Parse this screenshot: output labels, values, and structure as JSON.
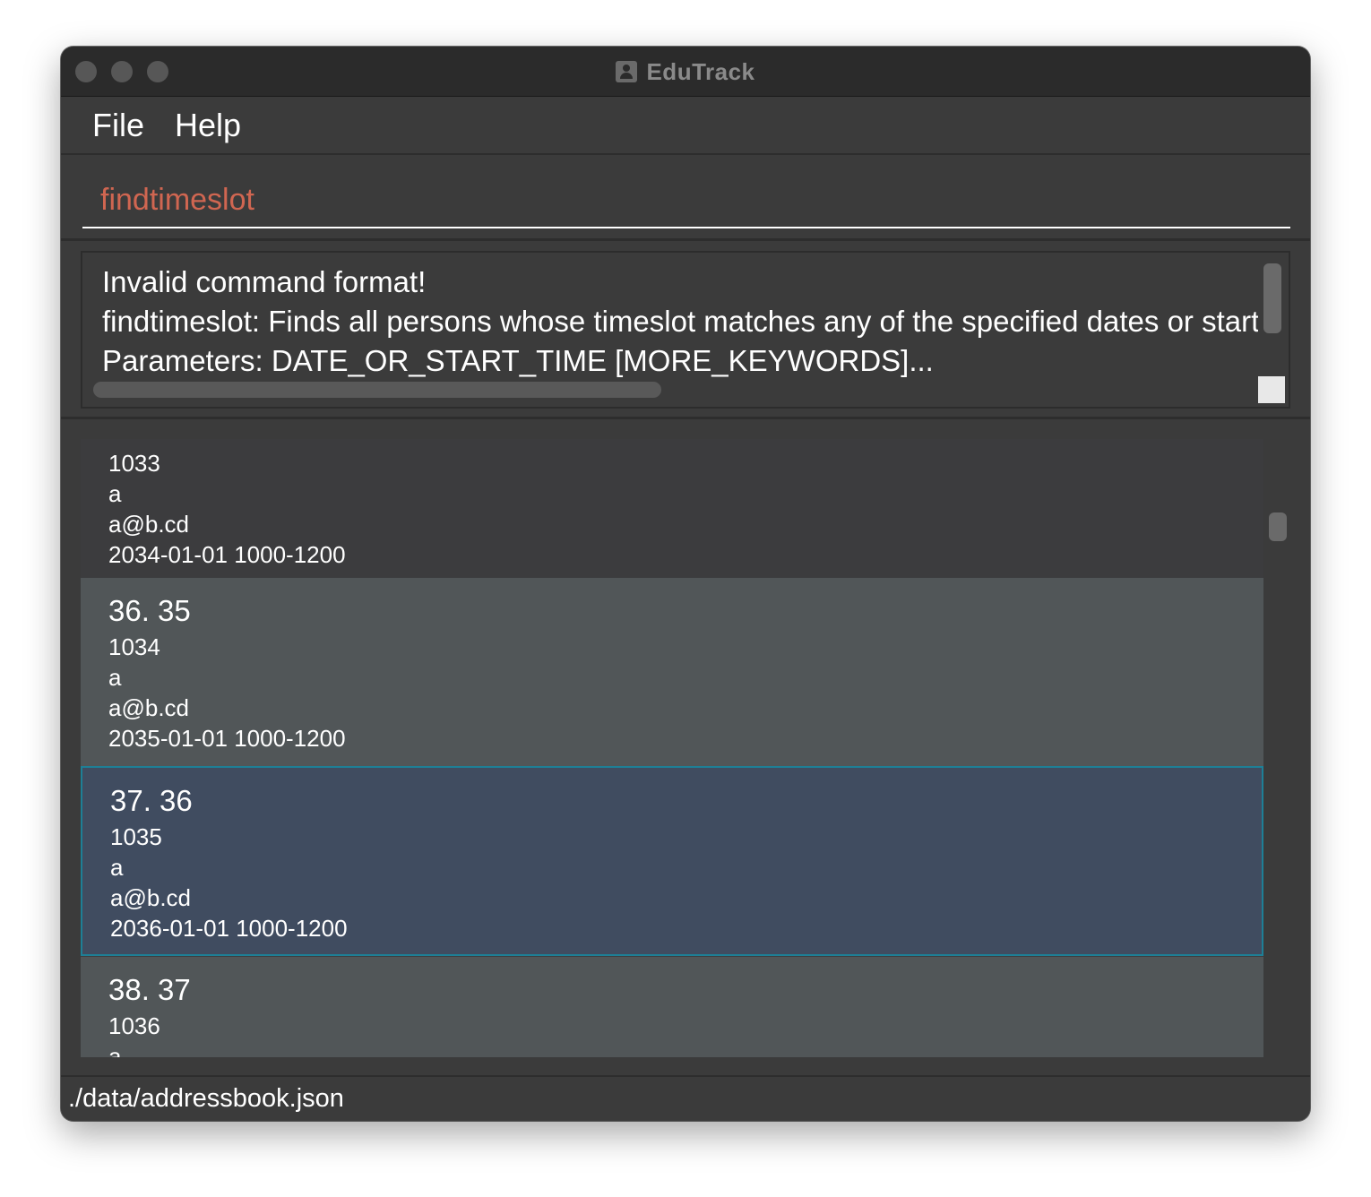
{
  "window": {
    "title": "EduTrack"
  },
  "menu": {
    "file": "File",
    "help": "Help"
  },
  "command": {
    "value": "findtimeslot"
  },
  "result": {
    "line1": "Invalid command format!",
    "line2": "findtimeslot: Finds all persons whose timeslot matches any of the specified dates or start ti",
    "line3": "Parameters: DATE_OR_START_TIME [MORE_KEYWORDS]..."
  },
  "persons": [
    {
      "header": "",
      "id": "1033",
      "name": "a",
      "email": "a@b.cd",
      "timeslot": "2034-01-01 1000-1200"
    },
    {
      "header": "36. 35",
      "id": "1034",
      "name": "a",
      "email": "a@b.cd",
      "timeslot": "2035-01-01 1000-1200"
    },
    {
      "header": "37. 36",
      "id": "1035",
      "name": "a",
      "email": "a@b.cd",
      "timeslot": "2036-01-01 1000-1200"
    },
    {
      "header": "38. 37",
      "id": "1036",
      "name": "a",
      "email": "",
      "timeslot": ""
    }
  ],
  "status": {
    "path": "./data/addressbook.json"
  }
}
